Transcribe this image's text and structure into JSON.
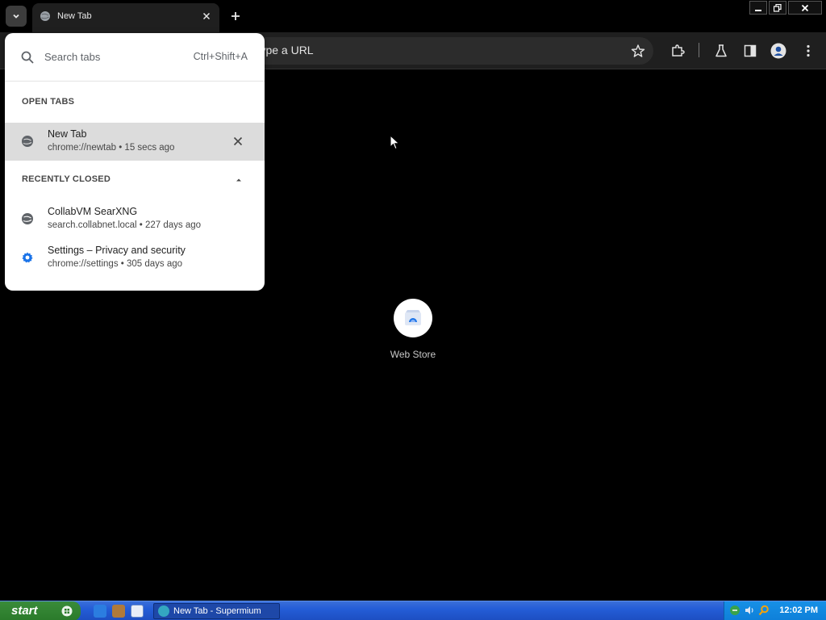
{
  "browser": {
    "tab": {
      "title": "New Tab"
    },
    "omnibox": {
      "text": "r type a URL"
    }
  },
  "tab_search": {
    "placeholder": "Search tabs",
    "shortcut": "Ctrl+Shift+A",
    "open_tabs_heading": "OPEN TABS",
    "open_tabs": [
      {
        "title": "New Tab",
        "subtitle": "chrome://newtab • 15 secs ago",
        "icon": "globe-icon"
      }
    ],
    "recently_closed_heading": "RECENTLY CLOSED",
    "recently_closed": [
      {
        "title": "CollabVM SearXNG",
        "subtitle": "search.collabnet.local • 227 days ago",
        "icon": "globe-icon"
      },
      {
        "title": "Settings – Privacy and security",
        "subtitle": "chrome://settings • 305 days ago",
        "icon": "gear-icon"
      }
    ]
  },
  "new_tab_page": {
    "shortcut": {
      "label": "Web Store",
      "icon": "web-store-icon"
    }
  },
  "taskbar": {
    "start_label": "start",
    "task_label": "New Tab - Supermium",
    "clock": "12:02 PM"
  },
  "colors": {
    "accent_blue": "#1a73e8",
    "taskbar_blue": "#245dd7",
    "start_green": "#2a7a2a"
  }
}
